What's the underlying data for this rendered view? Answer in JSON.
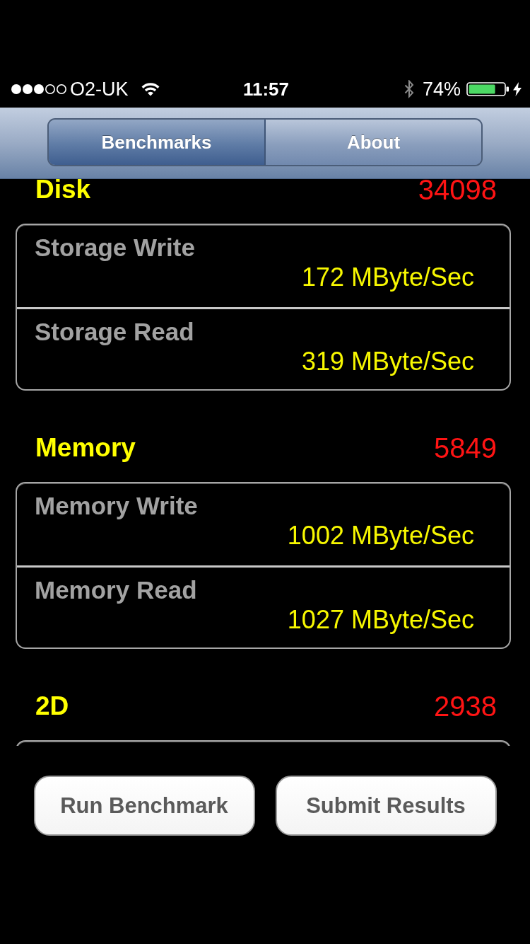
{
  "status_bar": {
    "carrier": "O2-UK",
    "time": "11:57",
    "battery_percent": "74%"
  },
  "tabs": [
    {
      "label": "Benchmarks",
      "selected": true
    },
    {
      "label": "About",
      "selected": false
    }
  ],
  "sections": [
    {
      "title": "Disk",
      "score": "34098",
      "results": [
        {
          "label": "Storage Write",
          "value": "172 MByte/Sec"
        },
        {
          "label": "Storage Read",
          "value": "319 MByte/Sec"
        }
      ]
    },
    {
      "title": "Memory",
      "score": "5849",
      "results": [
        {
          "label": "Memory Write",
          "value": "1002 MByte/Sec"
        },
        {
          "label": "Memory Read",
          "value": "1027 MByte/Sec"
        }
      ]
    },
    {
      "title": "2D",
      "score": "2938"
    }
  ],
  "buttons": [
    {
      "label": "Run Benchmark"
    },
    {
      "label": "Submit Results"
    }
  ]
}
